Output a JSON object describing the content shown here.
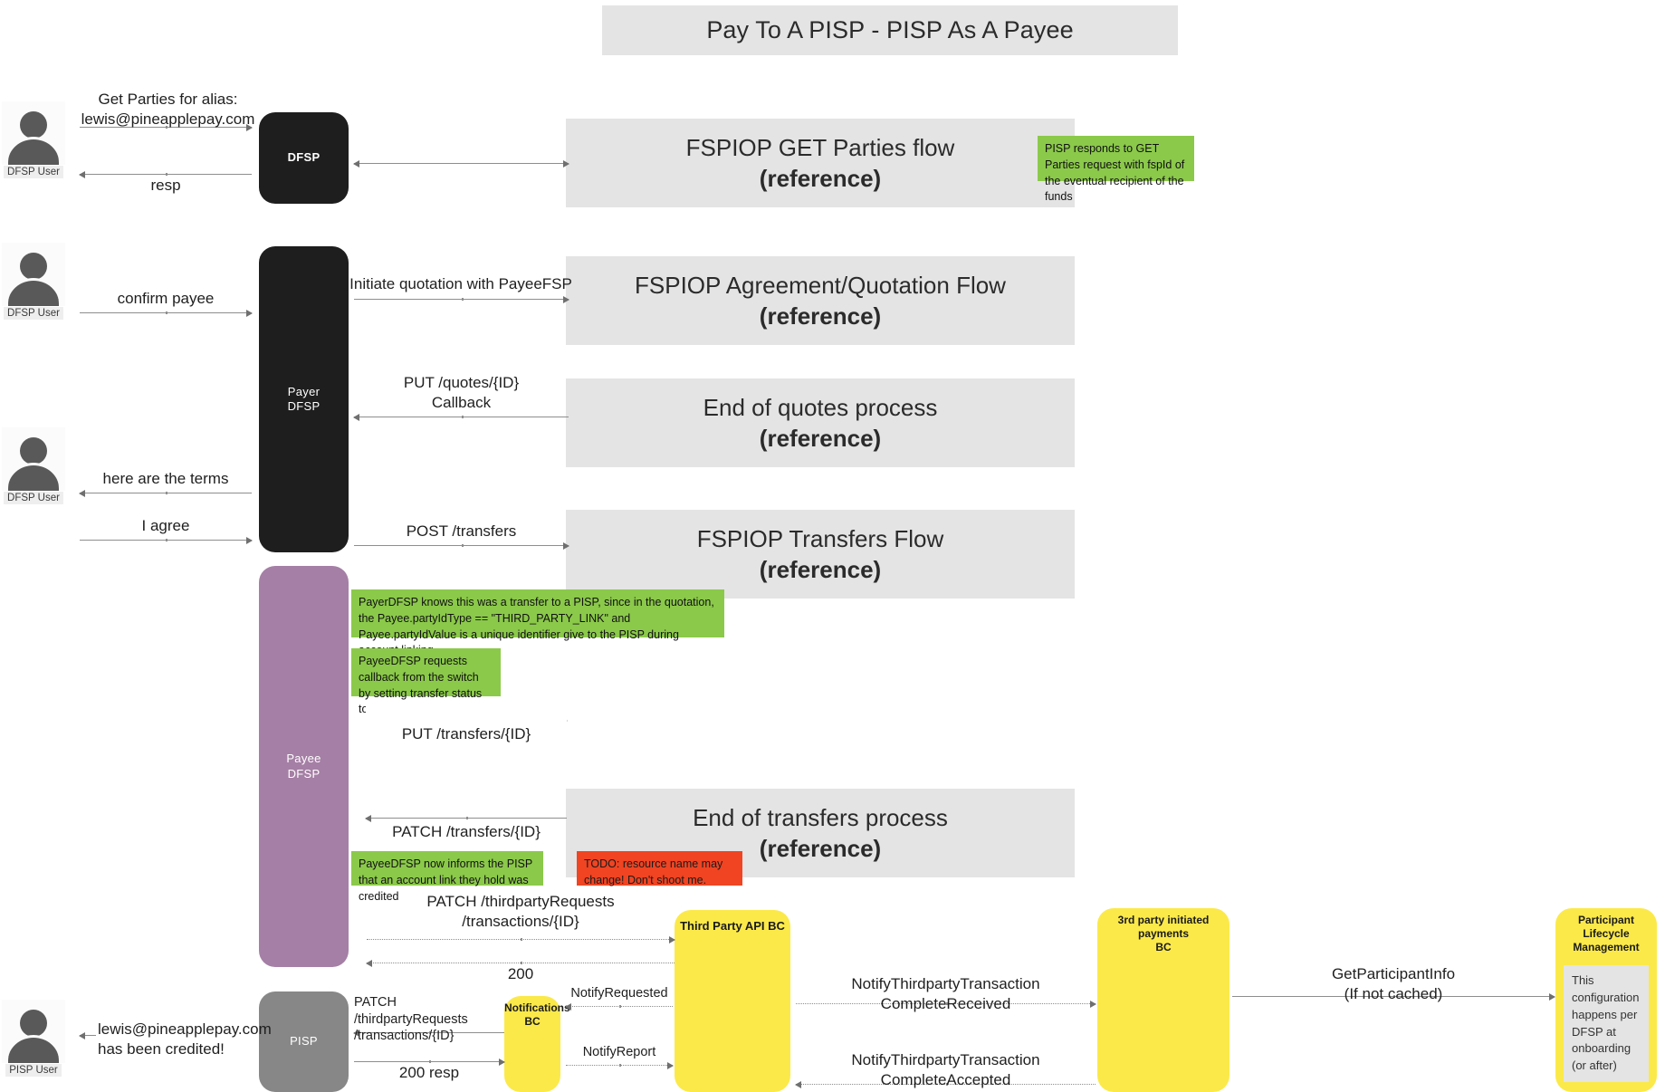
{
  "title": "Pay To A PISP - PISP As A Payee",
  "actors": [
    {
      "id": "dfsp-user-1",
      "label": "DFSP User"
    },
    {
      "id": "dfsp-user-2",
      "label": "DFSP User"
    },
    {
      "id": "dfsp-user-3",
      "label": "DFSP User"
    },
    {
      "id": "pisp-user",
      "label": "PISP User"
    }
  ],
  "lifelines": [
    {
      "id": "dfsp",
      "label": "DFSP",
      "color": "#1e1e1e"
    },
    {
      "id": "payer-dfsp",
      "label": "Payer\nDFSP",
      "color": "#1e1e1e"
    },
    {
      "id": "payee-dfsp",
      "label": "Payee\nDFSP",
      "color": "#a57fa5"
    },
    {
      "id": "pisp",
      "label": "PISP",
      "color": "#878787"
    }
  ],
  "bounded_contexts": [
    {
      "id": "third-party-api-bc",
      "label": "Third Party API BC"
    },
    {
      "id": "notifications-bc",
      "label": "Notifications\nBC"
    },
    {
      "id": "third-party-payments-bc",
      "label": "3rd party initiated payments\nBC"
    },
    {
      "id": "participant-lifecycle-management",
      "label": "Participant Lifecycle\nManagement",
      "note": "This configuration happens per DFSP at onboarding (or after)"
    }
  ],
  "references": [
    {
      "id": "ref-get-parties",
      "title": "FSPIOP GET Parties flow",
      "sub": "(reference)"
    },
    {
      "id": "ref-quotation",
      "title": "FSPIOP Agreement/Quotation Flow",
      "sub": "(reference)"
    },
    {
      "id": "ref-end-quotes",
      "title": "End of quotes process",
      "sub": "(reference)"
    },
    {
      "id": "ref-transfers",
      "title": "FSPIOP Transfers Flow",
      "sub": "(reference)"
    },
    {
      "id": "ref-end-transfers",
      "title": "End of transfers process",
      "sub": "(reference)"
    }
  ],
  "notes": [
    {
      "id": "note-pisp-responds",
      "type": "green",
      "text": "PISP responds to GET Parties request with fspId of the eventual recipient of the funds"
    },
    {
      "id": "note-payerdfsp-knows",
      "type": "green",
      "text": "PayerDFSP knows this was a transfer to a PISP, since in the quotation, the Payee.partyIdType == \"THIRD_PARTY_LINK\" and Payee.partyIdValue is a unique identifier give to the PISP during account linking."
    },
    {
      "id": "note-payeedfsp-callback",
      "type": "green",
      "text": "PayeeDFSP requests callback from the switch by setting transfer status to \"RESERVED\""
    },
    {
      "id": "note-payeedfsp-informs",
      "type": "green",
      "text": "PayeeDFSP now informs the PISP that an account link they hold was credited"
    },
    {
      "id": "note-todo",
      "type": "red",
      "text": "TODO: resource name may change! Don't shoot me."
    }
  ],
  "messages": [
    {
      "id": "msg-get-parties",
      "text": "Get Parties for alias:\nlewis@pineapplepay.com"
    },
    {
      "id": "msg-resp",
      "text": "resp"
    },
    {
      "id": "msg-dfsp-to-ref",
      "text": ""
    },
    {
      "id": "msg-confirm-payee",
      "text": "confirm payee"
    },
    {
      "id": "msg-initiate-quotation",
      "text": "Initiate quotation with PayeeFSP"
    },
    {
      "id": "msg-put-quotes",
      "text": "PUT /quotes/{ID}\nCallback"
    },
    {
      "id": "msg-here-are-terms",
      "text": "here are the terms"
    },
    {
      "id": "msg-i-agree",
      "text": "I agree"
    },
    {
      "id": "msg-post-transfers",
      "text": "POST /transfers"
    },
    {
      "id": "msg-put-transfers-id",
      "text": "PUT /transfers/{ID}"
    },
    {
      "id": "msg-patch-transfers-id",
      "text": "PATCH /transfers/{ID}"
    },
    {
      "id": "msg-patch-thirdparty-tpapi",
      "text": "PATCH /thirdpartyRequests\n/transactions/{ID}"
    },
    {
      "id": "msg-200",
      "text": "200"
    },
    {
      "id": "msg-patch-thirdparty-pisp",
      "text": "PATCH /thirdpartyRequests\n/transactions/{ID}"
    },
    {
      "id": "msg-200-resp",
      "text": "200 resp"
    },
    {
      "id": "msg-notify-requested",
      "text": "NotifyRequested"
    },
    {
      "id": "msg-notify-report",
      "text": "NotifyReport"
    },
    {
      "id": "msg-notify-complete-received",
      "text": "NotifyThirdpartyTransaction\nCompleteReceived"
    },
    {
      "id": "msg-notify-complete-accepted",
      "text": "NotifyThirdpartyTransaction\nCompleteAccepted"
    },
    {
      "id": "msg-get-participant-info",
      "text": "GetParticipantInfo\n(If not cached)"
    },
    {
      "id": "msg-credited",
      "text": "lewis@pineapplepay.com\nhas been credited!"
    }
  ],
  "colors": {
    "reference_bg": "#e4e4e4",
    "note_green": "#8bc94a",
    "note_red": "#f04422",
    "bc_yellow": "#fbe94a",
    "payee_purple": "#a57fa5",
    "pisp_grey": "#878787",
    "dfsp_black": "#1e1e1e"
  }
}
